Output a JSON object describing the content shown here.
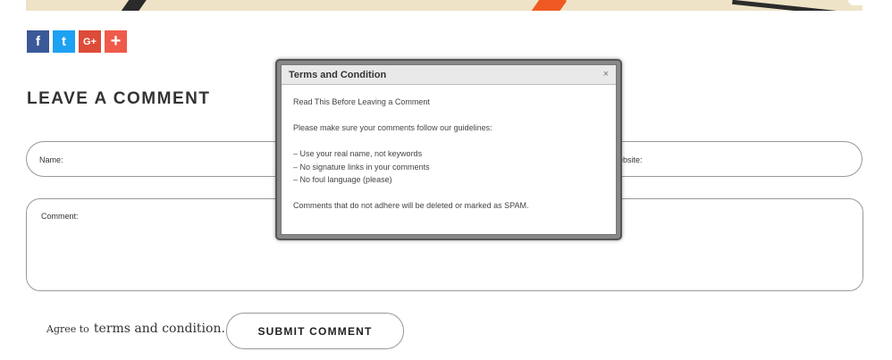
{
  "share": {
    "facebook_glyph": "f",
    "twitter_glyph": "t",
    "googleplus_glyph": "G+",
    "more_glyph": "+"
  },
  "comment_section": {
    "heading": "LEAVE A COMMENT",
    "name_label": "Name:",
    "website_label": "ebsite:",
    "comment_label": "Comment:",
    "agree_prefix": "Agree to",
    "agree_link": "terms and condition.",
    "submit_label": "SUBMIT COMMENT"
  },
  "modal": {
    "title": "Terms and Condition",
    "close_glyph": "×",
    "intro": "Read This Before Leaving a Comment",
    "guidelines_intro": "Please make sure your comments follow our guidelines:",
    "rules": [
      "– Use your real name, not keywords",
      "– No signature links in your comments",
      "– No foul language (please)"
    ],
    "footer": "Comments that do not adhere will be deleted or marked as SPAM."
  },
  "colors": {
    "facebook": "#3b5998",
    "twitter": "#1da1f2",
    "googleplus": "#dd4b39",
    "more": "#f05a4a",
    "hero_accent": "#f05a22"
  }
}
